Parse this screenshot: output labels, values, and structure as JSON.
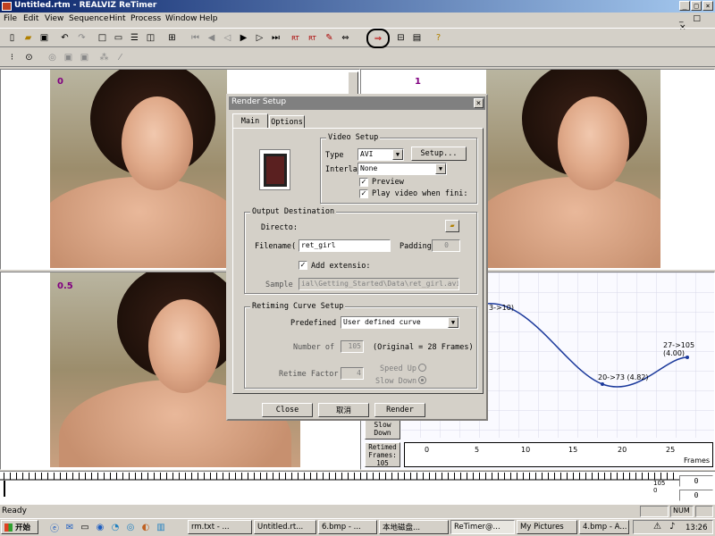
{
  "window": {
    "title": "Untitled.rtm - REALVIZ ReTimer",
    "controls": [
      "_",
      "□",
      "×"
    ]
  },
  "menu": [
    "File",
    "Edit",
    "View",
    "Sequence",
    "Hint",
    "Process",
    "Window",
    "Help"
  ],
  "panes": {
    "top_left_label": "0",
    "top_right_label": "1",
    "bottom_left_label": "0.5"
  },
  "curve": {
    "labels": {
      "p1": "3->10)",
      "p2": "20->73 (4.82)",
      "p3": "27->105 (4.00)"
    },
    "slow_down_label_1": "Slow",
    "slow_down_label_2": "Down",
    "retimed_label_1": "Retimed",
    "retimed_label_2": "Frames:",
    "retimed_value": "105",
    "axis_ticks": [
      "0",
      "5",
      "10",
      "15",
      "20",
      "25"
    ],
    "axis_unit": "Frames"
  },
  "timeline": {
    "marker_value": "105",
    "marker_value2": "0",
    "field1": "0",
    "field2": "0"
  },
  "status": {
    "ready": "Ready",
    "num": "NUM"
  },
  "taskbar": {
    "start": "开始",
    "items": [
      "rm.txt - ...",
      "Untitled.rt...",
      "6.bmp - ...",
      "本地磁盘...",
      "ReTimer@...",
      "My Pictures",
      "4.bmp - A..."
    ],
    "clock": "13:26"
  },
  "dialog": {
    "title": "Render Setup",
    "tabs": [
      "Main",
      "Options"
    ],
    "video_setup": {
      "title": "Video Setup",
      "type_label": "Type",
      "type_value": "AVI",
      "setup_button": "Setup...",
      "interlace_label": "Interla",
      "interlace_value": "None",
      "preview_label": "Preview",
      "play_label": "Play video when fini:"
    },
    "output": {
      "title": "Output Destination",
      "directory_label": "Directo:",
      "filename_label": "Filename(",
      "filename_value": "ret_girl",
      "padding_label": "Padding",
      "padding_value": "0",
      "add_ext_label": "Add extensio:",
      "sample_label": "Sample",
      "sample_value": "ial\\Getting_Started\\Data\\ret_girl.avi"
    },
    "retiming": {
      "title": "Retiming Curve Setup",
      "predefined_label": "Predefined",
      "predefined_value": "User defined curve",
      "number_label": "Number of",
      "number_value": "105",
      "original_text": "(Original = 28 Frames)",
      "factor_label": "Retime Factor",
      "factor_value": "4",
      "speed_up_label": "Speed Up",
      "slow_down_label": "Slow Down"
    },
    "buttons": {
      "close": "Close",
      "cancel": "取消",
      "render": "Render"
    }
  },
  "colors": {
    "title_active": "#0a246a",
    "title_gradient_end": "#a6caf0",
    "curve": "#1c3a9c",
    "pane_label": "#800080"
  }
}
